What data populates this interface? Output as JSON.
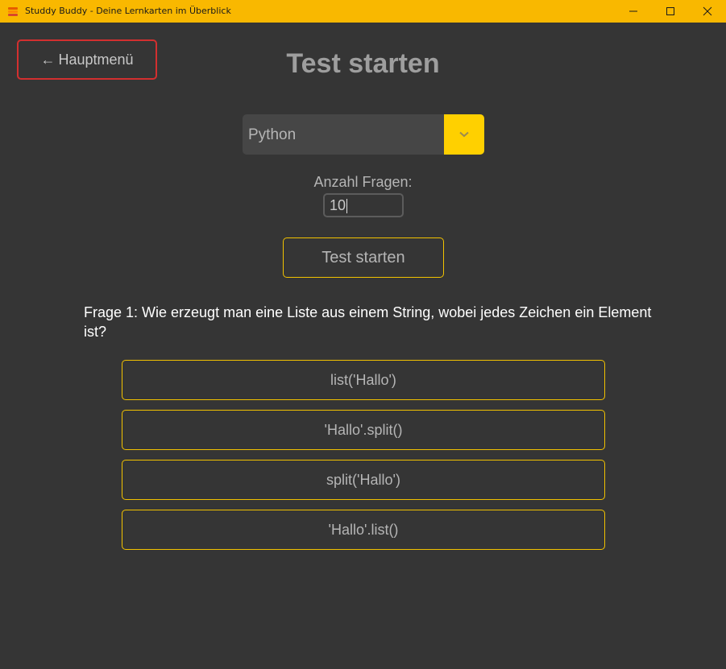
{
  "window": {
    "title": "Studdy Buddy - Deine Lernkarten im Überblick",
    "accent_color": "#f9b800",
    "app_icon": "stacked-cards-icon",
    "controls": [
      "minimize-icon",
      "maximize-icon",
      "close-icon"
    ]
  },
  "header": {
    "back_arrow": "←",
    "back_label": "Hauptmenü",
    "title": "Test starten"
  },
  "subject_select": {
    "selected": "Python",
    "arrow_icon": "chevron-down-icon"
  },
  "question_count": {
    "label": "Anzahl Fragen:",
    "value": "10"
  },
  "start_button": {
    "label": "Test starten"
  },
  "quiz": {
    "question": "Frage 1: Wie erzeugt man eine Liste aus einem String, wobei jedes Zeichen ein Element ist?",
    "answers": [
      "list('Hallo')",
      "'Hallo'.split()",
      "split('Hallo')",
      "'Hallo'.list()"
    ]
  }
}
